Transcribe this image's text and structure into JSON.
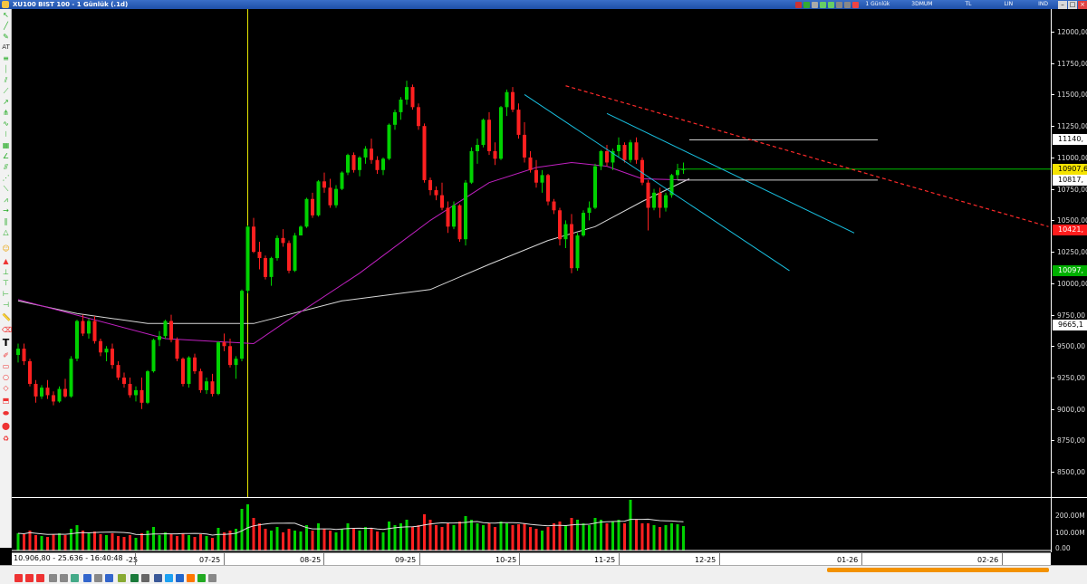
{
  "window": {
    "title": "XU100 BIST 100 - 1 Günlük (.1d)",
    "toolbox": {
      "period": "1 Günlük",
      "chart_mode": "3DMUM",
      "currency": "TL",
      "scale": "LIN",
      "indicator": "IND"
    }
  },
  "status": {
    "text": "10.906,80 - 25.636 - 16:40:48"
  },
  "left_toolbar": {
    "at_label": "AT"
  },
  "colors": {
    "up": "#00d200",
    "down": "#ff2020",
    "ma_fast": "#c020c0",
    "ma_slow": "#d8d8d8",
    "trend_red": "#ff2a2a",
    "channel": "#18c0e0",
    "level_green": "#00c000",
    "box": "#cfcfcf",
    "cursor": "#e8e800"
  },
  "price_axis": {
    "ticks": [
      "12000,00",
      "11750,00",
      "11500,00",
      "11250,00",
      "11000,00",
      "10750,00",
      "10500,00",
      "10250,00",
      "10000,00",
      "9750,00",
      "9500,00",
      "9250,00",
      "9000,00",
      "8750,00",
      "8500,00"
    ]
  },
  "price_tags": [
    {
      "label": "11140,",
      "value": 11140,
      "bg": "#ffffff",
      "fg": "#000000"
    },
    {
      "label": "10907,6",
      "value": 10907.6,
      "bg": "#f5e300",
      "fg": "#000000"
    },
    {
      "label": "10817,",
      "value": 10817,
      "bg": "#ffffff",
      "fg": "#000000"
    },
    {
      "label": "10421,",
      "value": 10421,
      "bg": "#ff1c1c",
      "fg": "#ffffff"
    },
    {
      "label": "10097,",
      "value": 10097,
      "bg": "#00b000",
      "fg": "#ffffff"
    },
    {
      "label": "9665,1",
      "value": 9665.1,
      "bg": "#ffffff",
      "fg": "#000000"
    }
  ],
  "volume_axis": {
    "ticks": [
      "200.00M",
      "100.00M",
      "0.00"
    ]
  },
  "x_axis": {
    "ticks": [
      "-25",
      "07-25",
      "08-25",
      "09-25",
      "10-25",
      "11-25",
      "12-25",
      "01-26",
      "02-26"
    ]
  },
  "chart_data": {
    "type": "candlestick",
    "interval": "1d",
    "ylim": [
      8300,
      12180
    ],
    "volume_ylim": [
      0,
      290
    ],
    "candles": [
      [
        9430,
        9520,
        9370,
        9480,
        95
      ],
      [
        9480,
        9520,
        9350,
        9380,
        90
      ],
      [
        9380,
        9400,
        9180,
        9200,
        110
      ],
      [
        9200,
        9230,
        9050,
        9100,
        85
      ],
      [
        9100,
        9190,
        9080,
        9170,
        80
      ],
      [
        9170,
        9230,
        9080,
        9110,
        75
      ],
      [
        9110,
        9140,
        9030,
        9060,
        90
      ],
      [
        9060,
        9180,
        9050,
        9160,
        95
      ],
      [
        9160,
        9240,
        9090,
        9100,
        85
      ],
      [
        9100,
        9420,
        9090,
        9400,
        120
      ],
      [
        9400,
        9710,
        9380,
        9700,
        140
      ],
      [
        9700,
        9750,
        9580,
        9600,
        110
      ],
      [
        9600,
        9720,
        9560,
        9700,
        95
      ],
      [
        9700,
        9740,
        9520,
        9540,
        105
      ],
      [
        9540,
        9560,
        9420,
        9450,
        90
      ],
      [
        9450,
        9500,
        9380,
        9480,
        85
      ],
      [
        9480,
        9520,
        9320,
        9350,
        95
      ],
      [
        9350,
        9380,
        9230,
        9250,
        80
      ],
      [
        9250,
        9290,
        9170,
        9200,
        75
      ],
      [
        9200,
        9250,
        9090,
        9110,
        85
      ],
      [
        9110,
        9180,
        9060,
        9150,
        70
      ],
      [
        9150,
        9250,
        9000,
        9050,
        95
      ],
      [
        9050,
        9310,
        9040,
        9300,
        110
      ],
      [
        9300,
        9560,
        9290,
        9550,
        130
      ],
      [
        9550,
        9620,
        9500,
        9580,
        85
      ],
      [
        9580,
        9710,
        9560,
        9700,
        100
      ],
      [
        9700,
        9750,
        9530,
        9550,
        90
      ],
      [
        9550,
        9570,
        9380,
        9400,
        80
      ],
      [
        9400,
        9410,
        9180,
        9200,
        95
      ],
      [
        9200,
        9420,
        9170,
        9410,
        85
      ],
      [
        9410,
        9440,
        9280,
        9300,
        75
      ],
      [
        9300,
        9320,
        9130,
        9150,
        90
      ],
      [
        9150,
        9250,
        9120,
        9220,
        80
      ],
      [
        9220,
        9280,
        9100,
        9120,
        70
      ],
      [
        9120,
        9540,
        9110,
        9530,
        125
      ],
      [
        9530,
        9600,
        9460,
        9500,
        100
      ],
      [
        9500,
        9560,
        9330,
        9350,
        110
      ],
      [
        9350,
        9420,
        9240,
        9400,
        120
      ],
      [
        9400,
        9950,
        9380,
        9940,
        230
      ],
      [
        9940,
        10460,
        9920,
        10450,
        255
      ],
      [
        10450,
        10520,
        10240,
        10250,
        180
      ],
      [
        10250,
        10330,
        10110,
        10200,
        150
      ],
      [
        10200,
        10220,
        10030,
        10050,
        120
      ],
      [
        10050,
        10210,
        9980,
        10200,
        110
      ],
      [
        10200,
        10380,
        10180,
        10360,
        130
      ],
      [
        10360,
        10430,
        10290,
        10320,
        100
      ],
      [
        10320,
        10340,
        10080,
        10100,
        120
      ],
      [
        10100,
        10400,
        10090,
        10380,
        110
      ],
      [
        10380,
        10460,
        10380,
        10450,
        105
      ],
      [
        10450,
        10680,
        10440,
        10670,
        140
      ],
      [
        10670,
        10720,
        10520,
        10540,
        110
      ],
      [
        10540,
        10820,
        10530,
        10810,
        150
      ],
      [
        10810,
        10880,
        10720,
        10760,
        120
      ],
      [
        10760,
        10830,
        10600,
        10620,
        110
      ],
      [
        10620,
        10780,
        10600,
        10750,
        100
      ],
      [
        10750,
        10890,
        10740,
        10880,
        120
      ],
      [
        10880,
        11030,
        10860,
        11020,
        150
      ],
      [
        11020,
        11040,
        10880,
        10900,
        120
      ],
      [
        10900,
        11010,
        10850,
        11000,
        110
      ],
      [
        11000,
        11090,
        10950,
        11070,
        130
      ],
      [
        11070,
        11150,
        10950,
        10980,
        120
      ],
      [
        10980,
        11010,
        10870,
        10900,
        105
      ],
      [
        10900,
        11000,
        10860,
        10990,
        100
      ],
      [
        10990,
        11270,
        10980,
        11260,
        160
      ],
      [
        11260,
        11380,
        11220,
        11360,
        140
      ],
      [
        11360,
        11480,
        11300,
        11460,
        150
      ],
      [
        11460,
        11610,
        11420,
        11560,
        170
      ],
      [
        11560,
        11580,
        11380,
        11400,
        130
      ],
      [
        11400,
        11430,
        11220,
        11250,
        140
      ],
      [
        11250,
        11270,
        10800,
        10820,
        200
      ],
      [
        10820,
        10840,
        10700,
        10740,
        170
      ],
      [
        10740,
        10770,
        10660,
        10700,
        140
      ],
      [
        10700,
        10800,
        10580,
        10600,
        130
      ],
      [
        10600,
        10650,
        10400,
        10450,
        150
      ],
      [
        10450,
        10650,
        10430,
        10620,
        140
      ],
      [
        10620,
        10630,
        10330,
        10350,
        160
      ],
      [
        10350,
        10820,
        10300,
        10800,
        190
      ],
      [
        10800,
        11080,
        10790,
        11050,
        170
      ],
      [
        11050,
        11150,
        10950,
        11100,
        150
      ],
      [
        11100,
        11310,
        11080,
        11300,
        140
      ],
      [
        11300,
        11360,
        11020,
        11050,
        150
      ],
      [
        11050,
        11120,
        10940,
        10990,
        130
      ],
      [
        10990,
        11410,
        10980,
        11400,
        160
      ],
      [
        11400,
        11540,
        11330,
        11520,
        150
      ],
      [
        11520,
        11560,
        11360,
        11380,
        140
      ],
      [
        11380,
        11430,
        11150,
        11180,
        145
      ],
      [
        11180,
        11280,
        10960,
        11000,
        150
      ],
      [
        11000,
        11050,
        10880,
        10900,
        130
      ],
      [
        10900,
        10980,
        10760,
        10800,
        120
      ],
      [
        10800,
        10900,
        10720,
        10860,
        110
      ],
      [
        10860,
        10870,
        10620,
        10650,
        130
      ],
      [
        10650,
        10670,
        10550,
        10580,
        150
      ],
      [
        10580,
        10600,
        10300,
        10350,
        160
      ],
      [
        10350,
        10500,
        10280,
        10470,
        140
      ],
      [
        10470,
        10550,
        10080,
        10120,
        180
      ],
      [
        10120,
        10400,
        10100,
        10380,
        170
      ],
      [
        10380,
        10580,
        10370,
        10560,
        150
      ],
      [
        10560,
        10650,
        10500,
        10600,
        140
      ],
      [
        10600,
        10950,
        10590,
        10930,
        180
      ],
      [
        10930,
        11060,
        10900,
        11050,
        170
      ],
      [
        11050,
        11100,
        10930,
        10960,
        150
      ],
      [
        10960,
        11070,
        10900,
        11050,
        160
      ],
      [
        11050,
        11160,
        11000,
        11100,
        170
      ],
      [
        11100,
        11120,
        10960,
        10980,
        150
      ],
      [
        10980,
        11140,
        10960,
        11120,
        280
      ],
      [
        11120,
        11160,
        10950,
        10980,
        170
      ],
      [
        10980,
        11000,
        10780,
        10800,
        150
      ],
      [
        10800,
        10820,
        10420,
        10600,
        150
      ],
      [
        10600,
        10750,
        10580,
        10720,
        140
      ],
      [
        10720,
        10760,
        10520,
        10600,
        130
      ],
      [
        10600,
        10720,
        10570,
        10700,
        140
      ],
      [
        10700,
        10870,
        10680,
        10860,
        150
      ],
      [
        10860,
        10950,
        10820,
        10900,
        145
      ],
      [
        10900,
        10960,
        10870,
        10907,
        135
      ]
    ],
    "ma_fast": {
      "name": "",
      "values": [
        [
          0,
          9870
        ],
        [
          25,
          9560
        ],
        [
          40,
          9520
        ],
        [
          45,
          9680
        ],
        [
          58,
          10080
        ],
        [
          70,
          10500
        ],
        [
          80,
          10800
        ],
        [
          88,
          10920
        ],
        [
          94,
          10960
        ],
        [
          100,
          10930
        ],
        [
          106,
          10830
        ],
        [
          114,
          10820
        ]
      ]
    },
    "ma_slow": {
      "name": "",
      "values": [
        [
          0,
          9860
        ],
        [
          10,
          9760
        ],
        [
          22,
          9680
        ],
        [
          40,
          9680
        ],
        [
          55,
          9860
        ],
        [
          70,
          9950
        ],
        [
          80,
          10150
        ],
        [
          90,
          10340
        ],
        [
          98,
          10450
        ],
        [
          106,
          10650
        ],
        [
          114,
          10830
        ]
      ]
    },
    "annotations": {
      "trend_line": [
        [
          93,
          11570
        ],
        [
          175,
          10450
        ]
      ],
      "channel_upper": [
        [
          86,
          11500
        ],
        [
          131,
          10100
        ]
      ],
      "channel_lower": [
        [
          100,
          11350
        ],
        [
          142,
          10400
        ]
      ],
      "range_box_high": [
        [
          114,
          11140
        ],
        [
          146,
          11140
        ]
      ],
      "range_box_high_left": [
        [
          114,
          11170
        ],
        [
          132,
          11170
        ]
      ],
      "range_box_low": [
        [
          112,
          10820
        ],
        [
          146,
          10820
        ]
      ],
      "support_level": 10907.6,
      "cursor_index": 39
    }
  }
}
